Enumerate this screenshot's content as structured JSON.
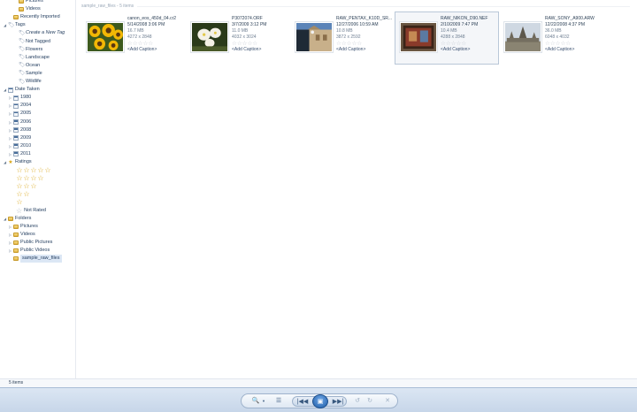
{
  "sidebar": {
    "items": [
      {
        "label": "Pictures",
        "icon": "folder-icon",
        "indent": 2
      },
      {
        "label": "Videos",
        "icon": "folder-icon",
        "indent": 2
      },
      {
        "label": "Recently Imported",
        "icon": "folder-icon",
        "indent": 1
      },
      {
        "label": "Tags",
        "icon": "tag-icon",
        "indent": 0,
        "twisty": "expanded"
      },
      {
        "label": "Create a New Tag",
        "icon": "tag-icon",
        "indent": 2,
        "italic": true
      },
      {
        "label": "Not Tagged",
        "icon": "tag-icon",
        "indent": 2
      },
      {
        "label": "Flowers",
        "icon": "tag-icon",
        "indent": 2
      },
      {
        "label": "Landscape",
        "icon": "tag-icon",
        "indent": 2
      },
      {
        "label": "Ocean",
        "icon": "tag-icon",
        "indent": 2
      },
      {
        "label": "Sample",
        "icon": "tag-icon",
        "indent": 2
      },
      {
        "label": "Wildlife",
        "icon": "tag-icon",
        "indent": 2
      },
      {
        "label": "Date Taken",
        "icon": "calendar-icon",
        "indent": 0,
        "twisty": "expanded"
      },
      {
        "label": "1980",
        "icon": "calendar-icon",
        "indent": 1,
        "twisty": "collapsed"
      },
      {
        "label": "2004",
        "icon": "calendar-icon",
        "indent": 1,
        "twisty": "collapsed"
      },
      {
        "label": "2005",
        "icon": "calendar-icon",
        "indent": 1,
        "twisty": "collapsed"
      },
      {
        "label": "2006",
        "icon": "calendar-icon",
        "indent": 1,
        "twisty": "collapsed"
      },
      {
        "label": "2008",
        "icon": "calendar-icon",
        "indent": 1,
        "twisty": "collapsed"
      },
      {
        "label": "2009",
        "icon": "calendar-icon",
        "indent": 1,
        "twisty": "collapsed"
      },
      {
        "label": "2010",
        "icon": "calendar-icon",
        "indent": 1,
        "twisty": "collapsed"
      },
      {
        "label": "2011",
        "icon": "calendar-icon",
        "indent": 1,
        "twisty": "collapsed"
      },
      {
        "label": "Ratings",
        "icon": "star-icon",
        "indent": 0,
        "twisty": "expanded"
      }
    ],
    "ratings": [
      5,
      4,
      3,
      2,
      1
    ],
    "ratings_not_rated": "Not Rated",
    "folder_items": [
      {
        "label": "Folders",
        "icon": "folder-icon",
        "indent": 0,
        "twisty": "expanded"
      },
      {
        "label": "Pictures",
        "icon": "folder-icon",
        "indent": 1,
        "twisty": "collapsed"
      },
      {
        "label": "Videos",
        "icon": "folder-icon",
        "indent": 1,
        "twisty": "collapsed"
      },
      {
        "label": "Public Pictures",
        "icon": "folder-icon",
        "indent": 1,
        "twisty": "collapsed"
      },
      {
        "label": "Public Videos",
        "icon": "folder-icon",
        "indent": 1,
        "twisty": "collapsed"
      },
      {
        "label": "sample_raw_files",
        "icon": "folder-icon",
        "indent": 1,
        "selected": true
      }
    ]
  },
  "group_header": "sample_raw_files - 5 items",
  "photos": [
    {
      "name": "canon_eos_450d_04.cr2",
      "date": "5/14/2008 3:06 PM",
      "size": "16.7 MB",
      "dims": "4272 x 2848",
      "caption": "<Add Caption>",
      "selected": false,
      "thumb": "sunflowers"
    },
    {
      "name": "P3072074.ORF",
      "date": "3/7/2009 3:12 PM",
      "size": "11.0 MB",
      "dims": "4032 x 3024",
      "caption": "<Add Caption>",
      "selected": false,
      "thumb": "white-flowers"
    },
    {
      "name": "RAW_PENTAX_K10D_SR...",
      "date": "12/27/2006 10:59 AM",
      "size": "10.8 MB",
      "dims": "3872 x 2592",
      "caption": "<Add Caption>",
      "selected": false,
      "thumb": "building"
    },
    {
      "name": "RAW_NIKON_D90.NEF",
      "date": "2/10/2009 7:47 PM",
      "size": "10.4 MB",
      "dims": "4288 x 2848",
      "caption": "<Add Caption>",
      "selected": true,
      "thumb": "painting"
    },
    {
      "name": "RAW_SONY_A900.ARW",
      "date": "12/22/2008 4:37 PM",
      "size": "36.0 MB",
      "dims": "6048 x 4032",
      "caption": "<Add Caption>",
      "selected": false,
      "thumb": "temple"
    }
  ],
  "rating_empty_stars": "☆☆☆☆☆",
  "status": {
    "text": "5 items"
  },
  "controls": {
    "zoom_icon": "🔍",
    "zoom_arrow": "▼",
    "size_icon": "☰",
    "prev_icon": "|◀◀",
    "slideshow_icon": "▣",
    "next_icon": "▶▶|",
    "rotate_left_icon": "↺",
    "rotate_right_icon": "↻",
    "delete_icon": "✕"
  }
}
